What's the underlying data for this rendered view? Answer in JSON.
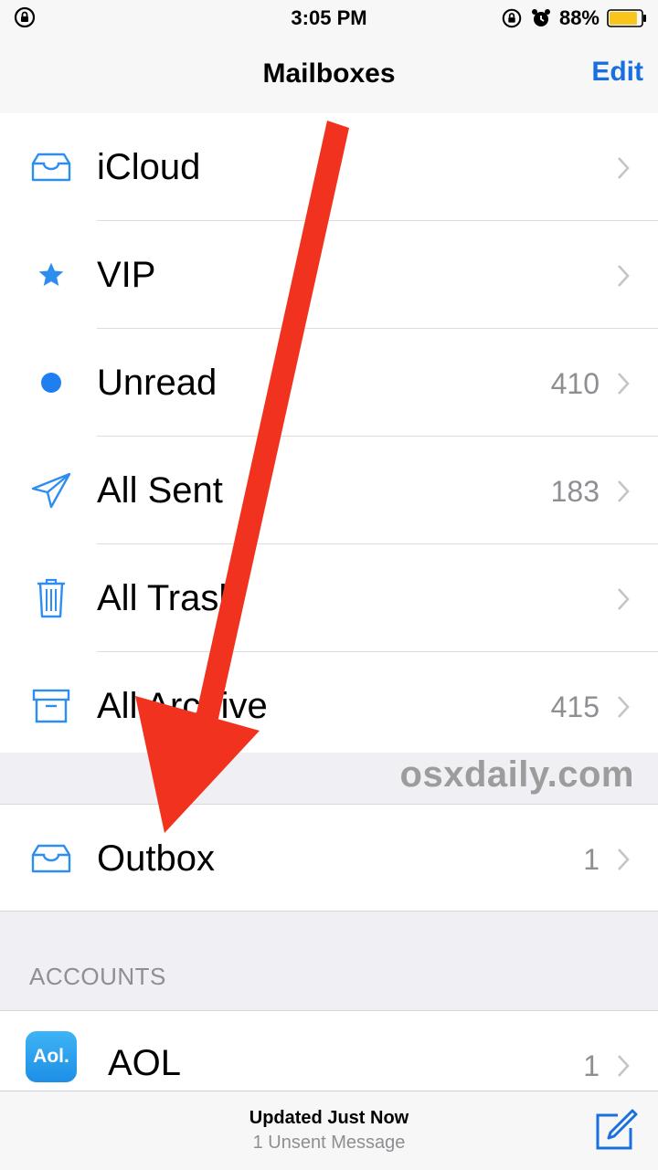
{
  "status_bar": {
    "time": "3:05 PM",
    "battery_percent": "88%",
    "battery_level": 0.88,
    "icons": [
      "rotation-lock-icon",
      "alarm-clock-icon",
      "battery-icon"
    ]
  },
  "nav": {
    "title": "Mailboxes",
    "edit_label": "Edit"
  },
  "mailboxes": [
    {
      "label": "iCloud",
      "count": "",
      "icon": "inbox-tray-icon"
    },
    {
      "label": "VIP",
      "count": "",
      "icon": "star-icon"
    },
    {
      "label": "Unread",
      "count": "410",
      "icon": "unread-dot-icon"
    },
    {
      "label": "All Sent",
      "count": "183",
      "icon": "paper-plane-icon"
    },
    {
      "label": "All Trash",
      "count": "",
      "icon": "trash-can-icon"
    },
    {
      "label": "All Archive",
      "count": "415",
      "icon": "archive-box-icon"
    }
  ],
  "watermark": "osxdaily.com",
  "outbox": {
    "label": "Outbox",
    "count": "1",
    "icon": "inbox-tray-icon"
  },
  "accounts": {
    "header": "ACCOUNTS",
    "items": [
      {
        "label": "AOL",
        "count": "1",
        "badge": "Aol."
      }
    ]
  },
  "toolbar": {
    "status": "Updated Just Now",
    "substatus": "1 Unsent Message",
    "compose_icon": "compose-icon"
  },
  "colors": {
    "accent": "#1a6fe0",
    "icon_blue": "#2d8ef0",
    "annotation_arrow": "#f0321e",
    "secondary_text": "#8e8e93"
  }
}
